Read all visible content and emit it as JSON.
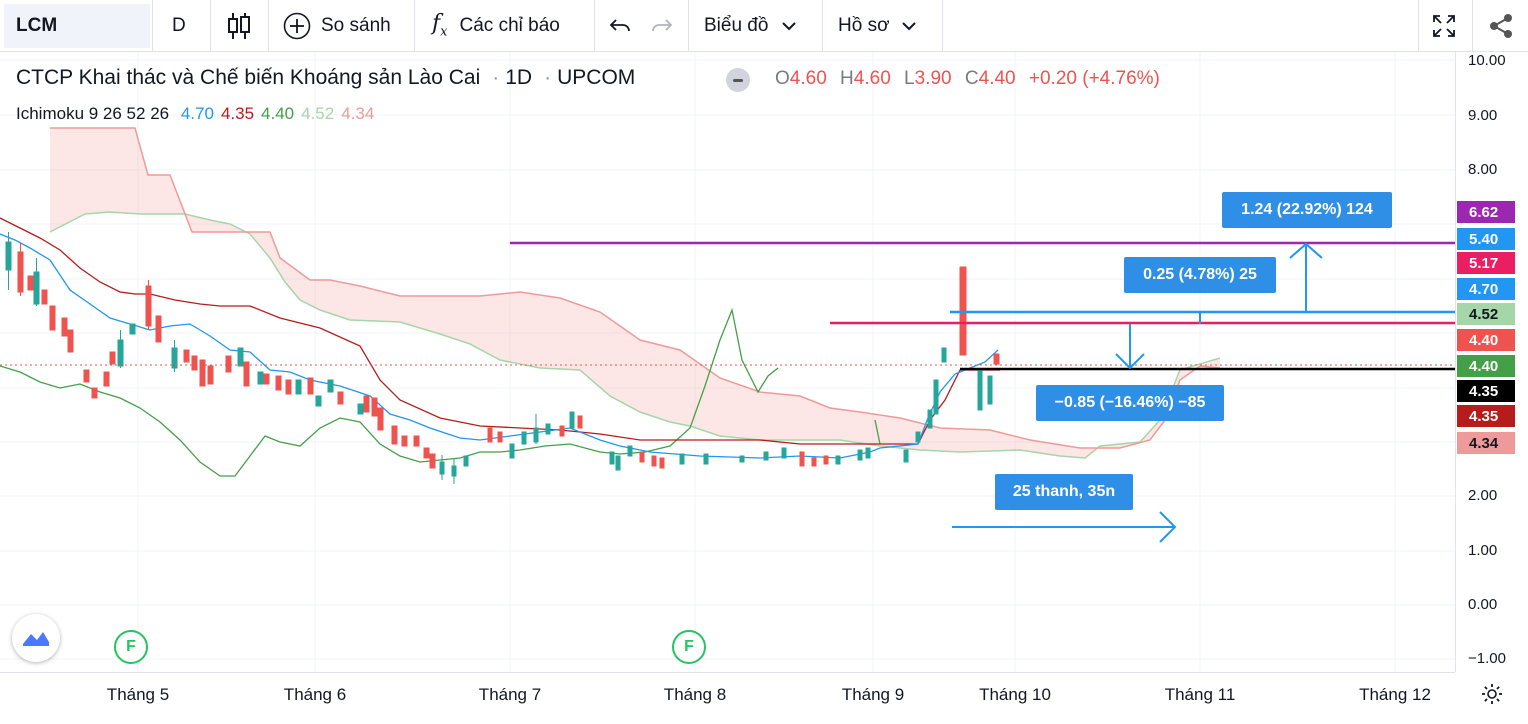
{
  "toolbar": {
    "symbol": "LCM",
    "interval": "D",
    "compare_label": "So sánh",
    "indicators_label": "Các chỉ báo",
    "chart_type_label": "Biểu đồ",
    "profile_label": "Hồ sơ"
  },
  "legend": {
    "title": "CTCP Khai thác và Chế biến Khoáng sản Lào Cai",
    "interval": "1D",
    "exchange": "UPCOM",
    "open_k": "O",
    "open": "4.60",
    "high_k": "H",
    "high": "4.60",
    "low_k": "L",
    "low": "3.90",
    "close_k": "C",
    "close": "4.40",
    "change": "+0.20 (+4.76%)"
  },
  "ichimoku": {
    "label": "Ichimoku 9 26 52 26",
    "values": [
      {
        "v": "4.70",
        "color": "#2196f3"
      },
      {
        "v": "4.35",
        "color": "#b71c1c"
      },
      {
        "v": "4.40",
        "color": "#43a047"
      },
      {
        "v": "4.52",
        "color": "#a5d6a7"
      },
      {
        "v": "4.34",
        "color": "#ef9a9a"
      }
    ]
  },
  "price_axis": {
    "ticks": [
      "10.00",
      "9.00",
      "8.00",
      "2.00",
      "1.00",
      "0.00",
      "−1.00"
    ],
    "labels": [
      {
        "text": "6.62",
        "color": "#9c27b0"
      },
      {
        "text": "5.40",
        "color": "#2196f3"
      },
      {
        "text": "5.17",
        "color": "#e91e63"
      },
      {
        "text": "4.70",
        "color": "#2196f3"
      },
      {
        "text": "4.52",
        "color": "#a5d6a7",
        "dark": true
      },
      {
        "text": "4.40",
        "color": "#ef5350"
      },
      {
        "text": "4.40",
        "color": "#43a047"
      },
      {
        "text": "4.35",
        "color": "#000000"
      },
      {
        "text": "4.35",
        "color": "#b71c1c"
      },
      {
        "text": "4.34",
        "color": "#ef9a9a",
        "dark": true
      }
    ]
  },
  "time_axis": {
    "ticks": [
      "Tháng 5",
      "Tháng 6",
      "Tháng 7",
      "Tháng 8",
      "Tháng 9",
      "Tháng 10",
      "Tháng 11",
      "Tháng 12"
    ]
  },
  "callouts": {
    "upper": "1.24 (22.92%) 124",
    "middle": "0.25 (4.78%) 25",
    "lower": "−0.85 (−16.46%) −85",
    "bars": "25 thanh, 35n"
  },
  "markers": {
    "f1": "F",
    "f2": "F"
  }
}
